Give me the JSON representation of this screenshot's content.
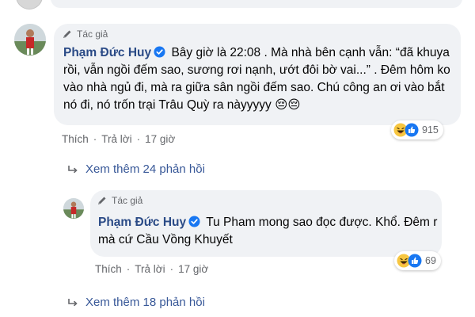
{
  "author_tag": "Tác giả",
  "colors": {
    "bubble_bg": "#f0f2f5",
    "name_color": "#2a4a86",
    "link_color": "#385898",
    "muted": "#65676b",
    "verified": "#1877f2"
  },
  "comment": {
    "name": "Phạm Đức Huy",
    "text_line1": "Bây giờ là 22:08 . Mà nhà bên cạnh vẫn: “đã khuya",
    "text_line2": "rồi, vẫn ngồi đếm sao, sương rơi nạnh, ướt đôi bờ vai...” . Đêm hôm ko",
    "text_line3": "vào nhà ngủ đi, mà ra giữa sân ngồi đếm sao. Chú công an ơi vào bắt",
    "text_line4": "nó đi, nó trốn trại Trâu Quỳ ra nàyyyyy 😔😔",
    "reaction_icons": [
      "haha-icon",
      "like-icon"
    ],
    "reaction_count": "915",
    "like_label": "Thích",
    "reply_label": "Trả lời",
    "time": "17 giờ"
  },
  "view_more_1": "Xem thêm 24 phản hồi",
  "reply": {
    "name": "Phạm Đức Huy",
    "text_line1_rest": "Tu Pham mong sao đọc được. Khổ. Đêm r",
    "text_line2": "mà cứ Cầu Vồng Khuyết",
    "reaction_icons": [
      "haha-icon",
      "like-icon"
    ],
    "reaction_count": "69",
    "like_label": "Thích",
    "reply_label": "Trả lời",
    "time": "17 giờ"
  },
  "view_more_2": "Xem thêm 18 phản hồi"
}
